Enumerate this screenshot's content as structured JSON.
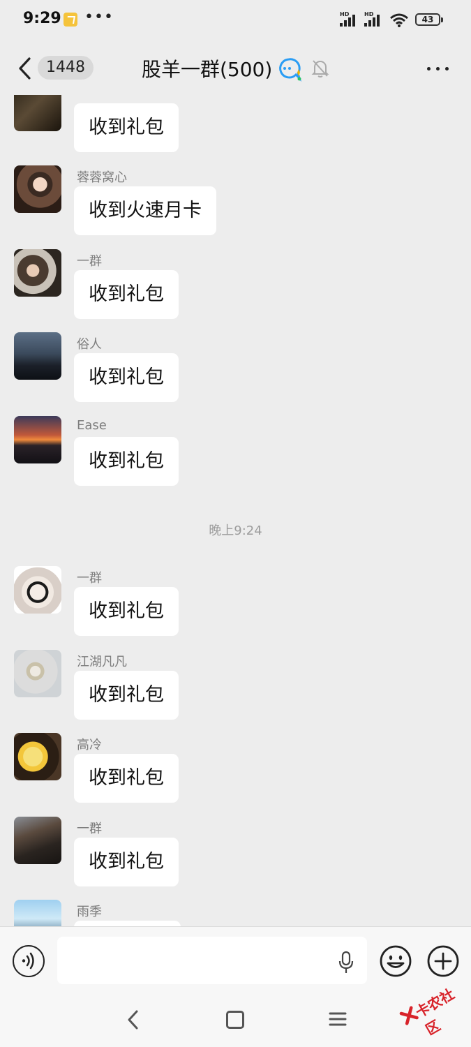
{
  "status_bar": {
    "time": "9:29",
    "dots": "•••",
    "battery": "43",
    "hd1": "HD",
    "hd2": "HD"
  },
  "header": {
    "back_count": "1448",
    "title": "股羊一群(500)"
  },
  "time_divider": "晚上9:24",
  "messages": [
    {
      "sender": "",
      "text": "收到礼包"
    },
    {
      "sender": "蓉蓉窝心",
      "text": "收到火速月卡"
    },
    {
      "sender": "一群",
      "text": "收到礼包"
    },
    {
      "sender": "俗人",
      "text": "收到礼包"
    },
    {
      "sender": "Ease",
      "text": "收到礼包"
    },
    {
      "sender": "一群",
      "text": "收到礼包"
    },
    {
      "sender": "江湖凡凡",
      "text": "收到礼包"
    },
    {
      "sender": "高冷",
      "text": "收到礼包"
    },
    {
      "sender": "一群",
      "text": "收到礼包"
    },
    {
      "sender": "雨季",
      "text": ""
    }
  ],
  "input": {
    "value": ""
  },
  "watermark": "卡农社区",
  "colors": {
    "background": "#ededed",
    "bubble": "#ffffff",
    "accent_blue": "#2a9df4",
    "watermark_red": "#d8232a"
  }
}
